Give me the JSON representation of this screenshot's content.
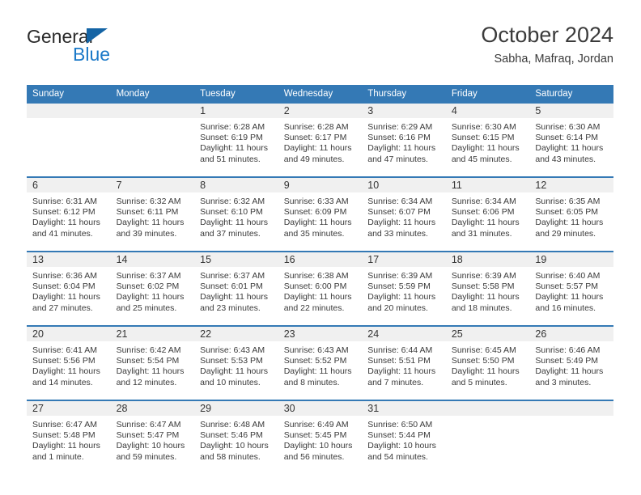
{
  "brand": {
    "name_part1": "General",
    "name_part2": "Blue",
    "triangle_color": "#1464a5",
    "blue_text_color": "#1b79c8"
  },
  "header": {
    "title": "October 2024",
    "location": "Sabha, Mafraq, Jordan"
  },
  "theme": {
    "header_bg": "#3479b5",
    "daynum_band_bg": "#f0f0f0",
    "separator_color": "#3479b5",
    "text_color": "#3a3a3a"
  },
  "weekday_headers": [
    "Sunday",
    "Monday",
    "Tuesday",
    "Wednesday",
    "Thursday",
    "Friday",
    "Saturday"
  ],
  "weeks": [
    [
      {
        "day": "",
        "blank": true,
        "sunrise": "",
        "sunset": "",
        "daylight1": "",
        "daylight2": ""
      },
      {
        "day": "",
        "blank": true,
        "sunrise": "",
        "sunset": "",
        "daylight1": "",
        "daylight2": ""
      },
      {
        "day": "1",
        "sunrise": "Sunrise: 6:28 AM",
        "sunset": "Sunset: 6:19 PM",
        "daylight1": "Daylight: 11 hours",
        "daylight2": "and 51 minutes."
      },
      {
        "day": "2",
        "sunrise": "Sunrise: 6:28 AM",
        "sunset": "Sunset: 6:17 PM",
        "daylight1": "Daylight: 11 hours",
        "daylight2": "and 49 minutes."
      },
      {
        "day": "3",
        "sunrise": "Sunrise: 6:29 AM",
        "sunset": "Sunset: 6:16 PM",
        "daylight1": "Daylight: 11 hours",
        "daylight2": "and 47 minutes."
      },
      {
        "day": "4",
        "sunrise": "Sunrise: 6:30 AM",
        "sunset": "Sunset: 6:15 PM",
        "daylight1": "Daylight: 11 hours",
        "daylight2": "and 45 minutes."
      },
      {
        "day": "5",
        "sunrise": "Sunrise: 6:30 AM",
        "sunset": "Sunset: 6:14 PM",
        "daylight1": "Daylight: 11 hours",
        "daylight2": "and 43 minutes."
      }
    ],
    [
      {
        "day": "6",
        "sunrise": "Sunrise: 6:31 AM",
        "sunset": "Sunset: 6:12 PM",
        "daylight1": "Daylight: 11 hours",
        "daylight2": "and 41 minutes."
      },
      {
        "day": "7",
        "sunrise": "Sunrise: 6:32 AM",
        "sunset": "Sunset: 6:11 PM",
        "daylight1": "Daylight: 11 hours",
        "daylight2": "and 39 minutes."
      },
      {
        "day": "8",
        "sunrise": "Sunrise: 6:32 AM",
        "sunset": "Sunset: 6:10 PM",
        "daylight1": "Daylight: 11 hours",
        "daylight2": "and 37 minutes."
      },
      {
        "day": "9",
        "sunrise": "Sunrise: 6:33 AM",
        "sunset": "Sunset: 6:09 PM",
        "daylight1": "Daylight: 11 hours",
        "daylight2": "and 35 minutes."
      },
      {
        "day": "10",
        "sunrise": "Sunrise: 6:34 AM",
        "sunset": "Sunset: 6:07 PM",
        "daylight1": "Daylight: 11 hours",
        "daylight2": "and 33 minutes."
      },
      {
        "day": "11",
        "sunrise": "Sunrise: 6:34 AM",
        "sunset": "Sunset: 6:06 PM",
        "daylight1": "Daylight: 11 hours",
        "daylight2": "and 31 minutes."
      },
      {
        "day": "12",
        "sunrise": "Sunrise: 6:35 AM",
        "sunset": "Sunset: 6:05 PM",
        "daylight1": "Daylight: 11 hours",
        "daylight2": "and 29 minutes."
      }
    ],
    [
      {
        "day": "13",
        "sunrise": "Sunrise: 6:36 AM",
        "sunset": "Sunset: 6:04 PM",
        "daylight1": "Daylight: 11 hours",
        "daylight2": "and 27 minutes."
      },
      {
        "day": "14",
        "sunrise": "Sunrise: 6:37 AM",
        "sunset": "Sunset: 6:02 PM",
        "daylight1": "Daylight: 11 hours",
        "daylight2": "and 25 minutes."
      },
      {
        "day": "15",
        "sunrise": "Sunrise: 6:37 AM",
        "sunset": "Sunset: 6:01 PM",
        "daylight1": "Daylight: 11 hours",
        "daylight2": "and 23 minutes."
      },
      {
        "day": "16",
        "sunrise": "Sunrise: 6:38 AM",
        "sunset": "Sunset: 6:00 PM",
        "daylight1": "Daylight: 11 hours",
        "daylight2": "and 22 minutes."
      },
      {
        "day": "17",
        "sunrise": "Sunrise: 6:39 AM",
        "sunset": "Sunset: 5:59 PM",
        "daylight1": "Daylight: 11 hours",
        "daylight2": "and 20 minutes."
      },
      {
        "day": "18",
        "sunrise": "Sunrise: 6:39 AM",
        "sunset": "Sunset: 5:58 PM",
        "daylight1": "Daylight: 11 hours",
        "daylight2": "and 18 minutes."
      },
      {
        "day": "19",
        "sunrise": "Sunrise: 6:40 AM",
        "sunset": "Sunset: 5:57 PM",
        "daylight1": "Daylight: 11 hours",
        "daylight2": "and 16 minutes."
      }
    ],
    [
      {
        "day": "20",
        "sunrise": "Sunrise: 6:41 AM",
        "sunset": "Sunset: 5:56 PM",
        "daylight1": "Daylight: 11 hours",
        "daylight2": "and 14 minutes."
      },
      {
        "day": "21",
        "sunrise": "Sunrise: 6:42 AM",
        "sunset": "Sunset: 5:54 PM",
        "daylight1": "Daylight: 11 hours",
        "daylight2": "and 12 minutes."
      },
      {
        "day": "22",
        "sunrise": "Sunrise: 6:43 AM",
        "sunset": "Sunset: 5:53 PM",
        "daylight1": "Daylight: 11 hours",
        "daylight2": "and 10 minutes."
      },
      {
        "day": "23",
        "sunrise": "Sunrise: 6:43 AM",
        "sunset": "Sunset: 5:52 PM",
        "daylight1": "Daylight: 11 hours",
        "daylight2": "and 8 minutes."
      },
      {
        "day": "24",
        "sunrise": "Sunrise: 6:44 AM",
        "sunset": "Sunset: 5:51 PM",
        "daylight1": "Daylight: 11 hours",
        "daylight2": "and 7 minutes."
      },
      {
        "day": "25",
        "sunrise": "Sunrise: 6:45 AM",
        "sunset": "Sunset: 5:50 PM",
        "daylight1": "Daylight: 11 hours",
        "daylight2": "and 5 minutes."
      },
      {
        "day": "26",
        "sunrise": "Sunrise: 6:46 AM",
        "sunset": "Sunset: 5:49 PM",
        "daylight1": "Daylight: 11 hours",
        "daylight2": "and 3 minutes."
      }
    ],
    [
      {
        "day": "27",
        "sunrise": "Sunrise: 6:47 AM",
        "sunset": "Sunset: 5:48 PM",
        "daylight1": "Daylight: 11 hours",
        "daylight2": "and 1 minute."
      },
      {
        "day": "28",
        "sunrise": "Sunrise: 6:47 AM",
        "sunset": "Sunset: 5:47 PM",
        "daylight1": "Daylight: 10 hours",
        "daylight2": "and 59 minutes."
      },
      {
        "day": "29",
        "sunrise": "Sunrise: 6:48 AM",
        "sunset": "Sunset: 5:46 PM",
        "daylight1": "Daylight: 10 hours",
        "daylight2": "and 58 minutes."
      },
      {
        "day": "30",
        "sunrise": "Sunrise: 6:49 AM",
        "sunset": "Sunset: 5:45 PM",
        "daylight1": "Daylight: 10 hours",
        "daylight2": "and 56 minutes."
      },
      {
        "day": "31",
        "sunrise": "Sunrise: 6:50 AM",
        "sunset": "Sunset: 5:44 PM",
        "daylight1": "Daylight: 10 hours",
        "daylight2": "and 54 minutes."
      },
      {
        "day": "",
        "blank": true,
        "sunrise": "",
        "sunset": "",
        "daylight1": "",
        "daylight2": ""
      },
      {
        "day": "",
        "blank": true,
        "sunrise": "",
        "sunset": "",
        "daylight1": "",
        "daylight2": ""
      }
    ]
  ]
}
